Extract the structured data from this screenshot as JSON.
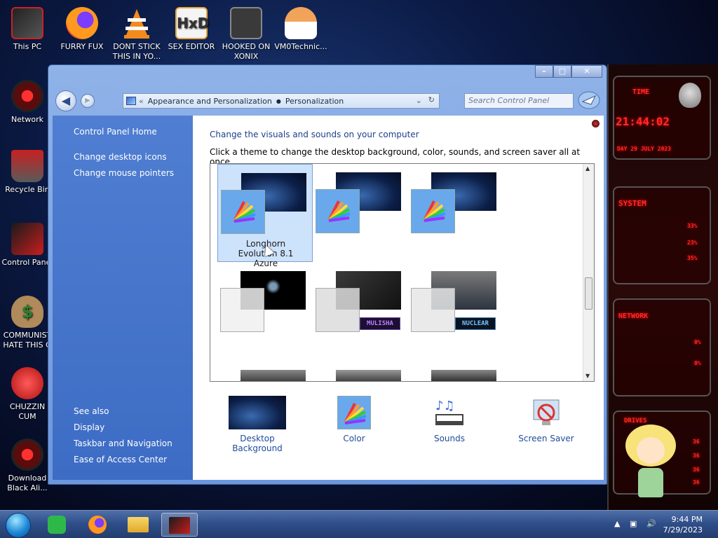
{
  "desktop": {
    "icons": [
      {
        "label": "This PC",
        "icon": "computer-icon"
      },
      {
        "label": "FURRY FUX",
        "icon": "firefox-icon"
      },
      {
        "label": "DONT STICK THIS IN YO...",
        "icon": "vlc-icon"
      },
      {
        "label": "SEX EDITOR",
        "icon": "hxd-icon"
      },
      {
        "label": "HOOKED ON XONIX",
        "icon": "game-icon"
      },
      {
        "label": "VM0Technic...",
        "icon": "doctor-icon"
      },
      {
        "label": "Network",
        "icon": "network-icon"
      },
      {
        "label": "Recycle Bin",
        "icon": "recycle-bin-icon"
      },
      {
        "label": "Control Panel",
        "icon": "control-panel-icon"
      },
      {
        "label": "COMMUNIST HATE THIS G",
        "icon": "money-bag-icon"
      },
      {
        "label": "CHUZZIN CUM",
        "icon": "chuzzle-icon"
      },
      {
        "label": "Download Black Ali...",
        "icon": "alien-icon"
      }
    ]
  },
  "widget": {
    "time_title": "TIME",
    "time": "21:44:02",
    "date": "DAY 29 JULY 2023",
    "system_title": "SYSTEM",
    "system_values": [
      "33%",
      "23%",
      "35%"
    ],
    "network_title": "NETWORK",
    "network_values": [
      "0%",
      "0%"
    ],
    "drives_title": "DRIVES",
    "drives_values": [
      "36",
      "36",
      "36",
      "36"
    ]
  },
  "window": {
    "address": {
      "prefix": "«",
      "segment1": "Appearance and Personalization",
      "segment2": "Personalization"
    },
    "search_placeholder": "Search Control Panel",
    "sidebar": {
      "home": "Control Panel Home",
      "links": [
        "Change desktop icons",
        "Change mouse pointers"
      ],
      "see_also_title": "See also",
      "see_also": [
        "Display",
        "Taskbar and Navigation",
        "Ease of Access Center"
      ]
    },
    "heading": "Change the visuals and sounds on your computer",
    "subtext": "Click a theme to change the desktop background, color, sounds, and screen saver all at once.",
    "themes": [
      {
        "name": "Longhorn Evolution 8.1 Azure",
        "selected": true
      },
      {
        "name": "",
        "selected": false
      },
      {
        "name": "",
        "selected": false
      },
      {
        "name": "",
        "selected": false
      },
      {
        "name": "",
        "selected": false,
        "badge": "MULISHA"
      },
      {
        "name": "",
        "selected": false,
        "badge": "NUCLEAR"
      }
    ],
    "bottom": {
      "desktop_background": "Desktop Background",
      "color": "Color",
      "sounds": "Sounds",
      "screen_saver": "Screen Saver"
    }
  },
  "taskbar": {
    "time": "9:44 PM",
    "date": "7/29/2023"
  }
}
